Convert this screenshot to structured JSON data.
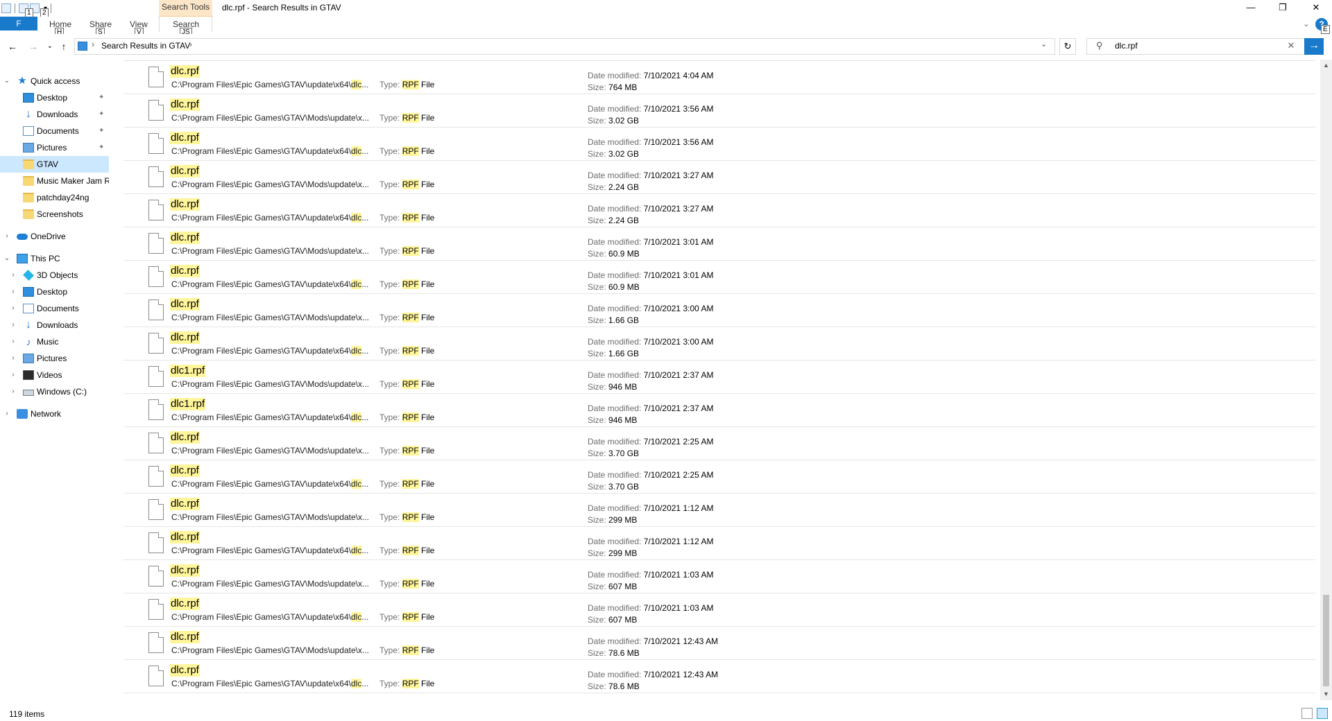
{
  "window": {
    "title": "dlc.rpf - Search Results in GTAV",
    "contextual_tab": "Search Tools",
    "minimize": "—",
    "maximize": "❐",
    "close": "✕",
    "help": "?"
  },
  "quick_access_toolbar": {
    "keytips": [
      "1",
      "2"
    ],
    "dropdown": "▾"
  },
  "ribbon": {
    "file": {
      "label": "F",
      "keytip": "F"
    },
    "tabs": [
      {
        "label": "Home",
        "keytip": "H"
      },
      {
        "label": "Share",
        "keytip": "S"
      },
      {
        "label": "View",
        "keytip": "V"
      },
      {
        "label": "Search",
        "keytip": "JS"
      }
    ],
    "collapse_keytip": "E"
  },
  "address_bar": {
    "back": "←",
    "forward": "→",
    "recent": "⌄",
    "up": "↑",
    "path": "Search Results in GTAV",
    "sep1": "›",
    "sep2": "›",
    "dropdown": "⌄",
    "refresh": "↻"
  },
  "search": {
    "value": "dlc.rpf",
    "icon": "⚲",
    "clear": "✕",
    "go": "→"
  },
  "nav_pane": {
    "items": [
      {
        "label": "Quick access",
        "icon": "star-icon",
        "glyph": "★",
        "chevron": "⌄",
        "pinned": false
      },
      {
        "label": "Desktop",
        "icon": "desktop-icon",
        "pinned": true
      },
      {
        "label": "Downloads",
        "icon": "downloads-icon",
        "glyph": "↓",
        "pinned": true
      },
      {
        "label": "Documents",
        "icon": "documents-icon",
        "pinned": true
      },
      {
        "label": "Pictures",
        "icon": "pictures-icon",
        "pinned": true
      },
      {
        "label": "GTAV",
        "icon": "folder-icon",
        "pinned": false,
        "selected": true
      },
      {
        "label": "Music Maker Jam R",
        "icon": "folder-icon",
        "pinned": false
      },
      {
        "label": "patchday24ng",
        "icon": "folder-icon",
        "pinned": false
      },
      {
        "label": "Screenshots",
        "icon": "folder-icon",
        "pinned": false
      },
      {
        "label": "OneDrive",
        "icon": "onedrive-icon",
        "chevron": "›"
      },
      {
        "label": "This PC",
        "icon": "this-pc-icon",
        "chevron": "⌄"
      },
      {
        "label": "3D Objects",
        "icon": "3d-objects-icon",
        "chevron": "›"
      },
      {
        "label": "Desktop",
        "icon": "desktop-icon",
        "chevron": "›"
      },
      {
        "label": "Documents",
        "icon": "documents-icon",
        "chevron": "›"
      },
      {
        "label": "Downloads",
        "icon": "downloads-icon",
        "glyph": "↓",
        "chevron": "›"
      },
      {
        "label": "Music",
        "icon": "music-icon",
        "glyph": "♪",
        "chevron": "›"
      },
      {
        "label": "Pictures",
        "icon": "pictures-icon",
        "chevron": "›"
      },
      {
        "label": "Videos",
        "icon": "videos-icon",
        "chevron": "›"
      },
      {
        "label": "Windows (C:)",
        "icon": "drive-icon",
        "chevron": "›"
      },
      {
        "label": "Network",
        "icon": "network-icon",
        "chevron": "›"
      }
    ],
    "pin_glyph": "📌"
  },
  "labels": {
    "type": "Type: ",
    "type_hl": "RPF",
    "type_rest": " File",
    "date": "Date modified: ",
    "size": "Size: "
  },
  "results": [
    {
      "name": "dlc.rpf",
      "path": "C:\\Program Files\\Epic Games\\GTAV\\Mods\\update\\x...",
      "date": "",
      "size": "764 MB",
      "partial": true
    },
    {
      "name": "dlc.rpf",
      "path_pre": "C:\\Program Files\\Epic Games\\GTAV\\update\\x64\\",
      "path_hl": "dlc",
      "path_post": "...",
      "date": "7/10/2021 4:04 AM",
      "size": "764 MB"
    },
    {
      "name": "dlc.rpf",
      "path": "C:\\Program Files\\Epic Games\\GTAV\\Mods\\update\\x...",
      "date": "7/10/2021 3:56 AM",
      "size": "3.02 GB"
    },
    {
      "name": "dlc.rpf",
      "path_pre": "C:\\Program Files\\Epic Games\\GTAV\\update\\x64\\",
      "path_hl": "dlc",
      "path_post": "...",
      "date": "7/10/2021 3:56 AM",
      "size": "3.02 GB"
    },
    {
      "name": "dlc.rpf",
      "path": "C:\\Program Files\\Epic Games\\GTAV\\Mods\\update\\x...",
      "date": "7/10/2021 3:27 AM",
      "size": "2.24 GB"
    },
    {
      "name": "dlc.rpf",
      "path_pre": "C:\\Program Files\\Epic Games\\GTAV\\update\\x64\\",
      "path_hl": "dlc",
      "path_post": "...",
      "date": "7/10/2021 3:27 AM",
      "size": "2.24 GB"
    },
    {
      "name": "dlc.rpf",
      "path": "C:\\Program Files\\Epic Games\\GTAV\\Mods\\update\\x...",
      "date": "7/10/2021 3:01 AM",
      "size": "60.9 MB"
    },
    {
      "name": "dlc.rpf",
      "path_pre": "C:\\Program Files\\Epic Games\\GTAV\\update\\x64\\",
      "path_hl": "dlc",
      "path_post": "...",
      "date": "7/10/2021 3:01 AM",
      "size": "60.9 MB"
    },
    {
      "name": "dlc.rpf",
      "path": "C:\\Program Files\\Epic Games\\GTAV\\Mods\\update\\x...",
      "date": "7/10/2021 3:00 AM",
      "size": "1.66 GB"
    },
    {
      "name": "dlc.rpf",
      "path_pre": "C:\\Program Files\\Epic Games\\GTAV\\update\\x64\\",
      "path_hl": "dlc",
      "path_post": "...",
      "date": "7/10/2021 3:00 AM",
      "size": "1.66 GB"
    },
    {
      "name": "dlc1.rpf",
      "path": "C:\\Program Files\\Epic Games\\GTAV\\Mods\\update\\x...",
      "date": "7/10/2021 2:37 AM",
      "size": "946 MB"
    },
    {
      "name": "dlc1.rpf",
      "path_pre": "C:\\Program Files\\Epic Games\\GTAV\\update\\x64\\",
      "path_hl": "dlc",
      "path_post": "...",
      "date": "7/10/2021 2:37 AM",
      "size": "946 MB"
    },
    {
      "name": "dlc.rpf",
      "path": "C:\\Program Files\\Epic Games\\GTAV\\Mods\\update\\x...",
      "date": "7/10/2021 2:25 AM",
      "size": "3.70 GB"
    },
    {
      "name": "dlc.rpf",
      "path_pre": "C:\\Program Files\\Epic Games\\GTAV\\update\\x64\\",
      "path_hl": "dlc",
      "path_post": "...",
      "date": "7/10/2021 2:25 AM",
      "size": "3.70 GB"
    },
    {
      "name": "dlc.rpf",
      "path": "C:\\Program Files\\Epic Games\\GTAV\\Mods\\update\\x...",
      "date": "7/10/2021 1:12 AM",
      "size": "299 MB"
    },
    {
      "name": "dlc.rpf",
      "path_pre": "C:\\Program Files\\Epic Games\\GTAV\\update\\x64\\",
      "path_hl": "dlc",
      "path_post": "...",
      "date": "7/10/2021 1:12 AM",
      "size": "299 MB"
    },
    {
      "name": "dlc.rpf",
      "path": "C:\\Program Files\\Epic Games\\GTAV\\Mods\\update\\x...",
      "date": "7/10/2021 1:03 AM",
      "size": "607 MB"
    },
    {
      "name": "dlc.rpf",
      "path_pre": "C:\\Program Files\\Epic Games\\GTAV\\update\\x64\\",
      "path_hl": "dlc",
      "path_post": "...",
      "date": "7/10/2021 1:03 AM",
      "size": "607 MB"
    },
    {
      "name": "dlc.rpf",
      "path": "C:\\Program Files\\Epic Games\\GTAV\\Mods\\update\\x...",
      "date": "7/10/2021 12:43 AM",
      "size": "78.6 MB"
    },
    {
      "name": "dlc.rpf",
      "path_pre": "C:\\Program Files\\Epic Games\\GTAV\\update\\x64\\",
      "path_hl": "dlc",
      "path_post": "...",
      "date": "7/10/2021 12:43 AM",
      "size": "78.6 MB"
    }
  ],
  "status": {
    "item_count": "119 items"
  },
  "scrollbar": {
    "up": "▲",
    "down": "▼"
  },
  "colors": {
    "accent": "#1979ca",
    "highlight": "#fff59a",
    "selected": "#cce8ff",
    "contextual": "#fde6c8"
  }
}
